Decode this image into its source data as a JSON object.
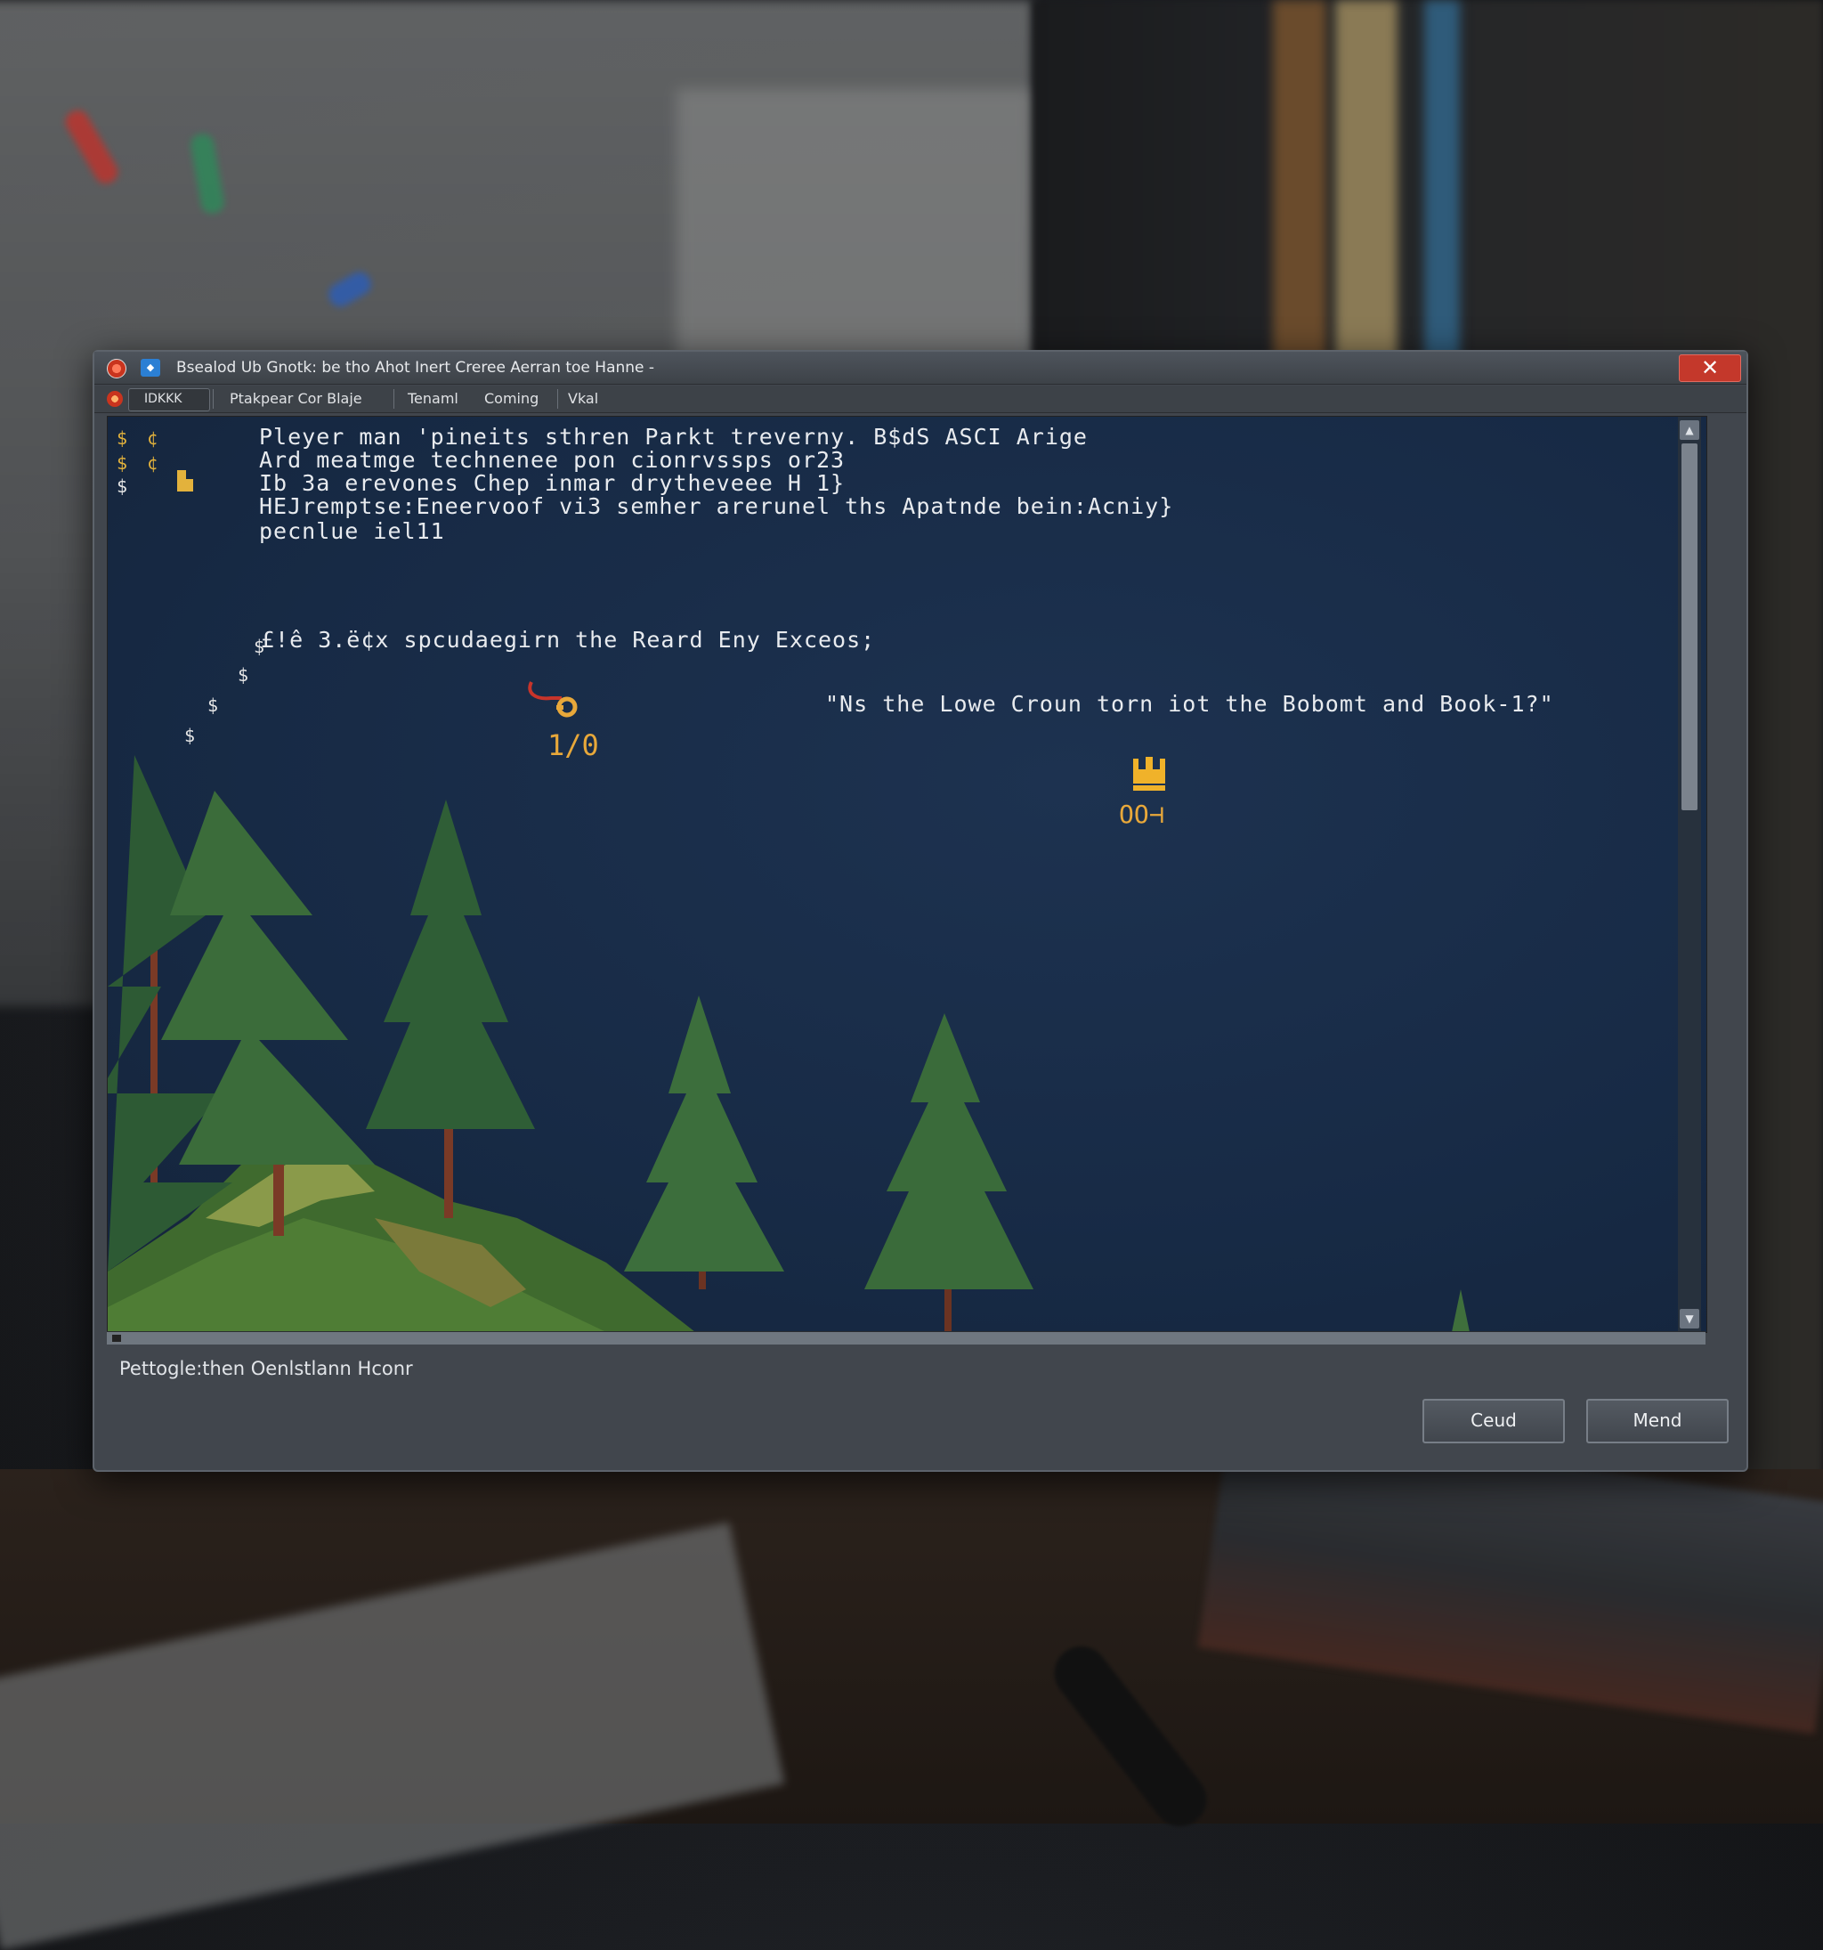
{
  "window": {
    "title": "Bsealod Ub Gnotk: be tho Ahot Inert Creree Aerran toe Hanne -",
    "close_glyph": "✕"
  },
  "menubar": {
    "items": [
      "IDKKK",
      "Ptakpear Cor Blaje",
      "Tenaml",
      "Coming",
      "Vkal"
    ]
  },
  "game": {
    "log_lines": [
      "Pleyer man 'pineits sthren Parkt treverny. B$dS ASCI Arige",
      "Ard meatmge technenee pon cionrvssps or23",
      "Ib 3a erevones Chep inmar drytheveee H 1}",
      "HEJremptse:Eneervoof vi3 semher arerunel ths Apatnde bein:Acniy}",
      "pecnlue iel11"
    ],
    "event_line": "£!ê 3.ë¢x spcudaegirn the Reard Eny Exceos;",
    "quote_line": "\"Ns the Lowe Croun torn iot the Bobomt and Book-1?\"",
    "left_glyphs": [
      "$",
      "¢",
      "$",
      "¢",
      "$",
      "$",
      "$",
      "$",
      "$"
    ],
    "key_counter": "1/0",
    "crown_counter": "OO⊣"
  },
  "statusbar": {
    "text": "Pettogle:then Oenlstlann Hconr"
  },
  "buttons": {
    "primary": "Ceud",
    "secondary": "Mend"
  },
  "scroll": {
    "up": "▲",
    "down": "▼"
  },
  "colors": {
    "viewport_bg": "#172a45",
    "close_button": "#c4382b",
    "accent_gold": "#e8a83a",
    "tree_dark": "#2f5a3a",
    "tree_light": "#4a7c3c"
  },
  "icons": {
    "key": "key-icon",
    "crown": "crown-icon",
    "app": "app-icon",
    "document": "document-icon"
  }
}
